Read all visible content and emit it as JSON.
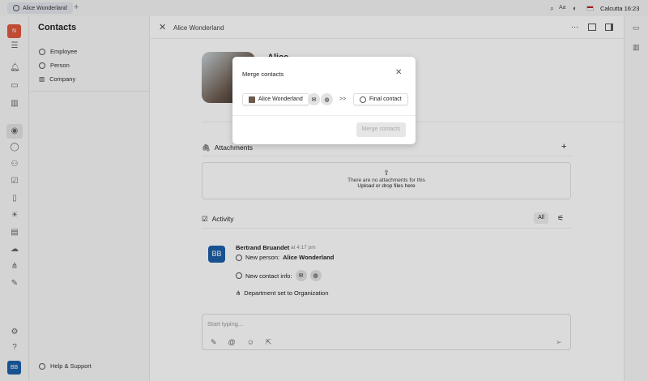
{
  "tab": {
    "title": "Alice Wonderland",
    "add": "+"
  },
  "topbar": {
    "font_label": "Aa",
    "clock": "Calcutta 16:23"
  },
  "workspace_initial": "N",
  "user_initials": "BB",
  "nav": {
    "title": "Contacts",
    "items": [
      {
        "label": "Employee"
      },
      {
        "label": "Person"
      },
      {
        "label": "Company"
      }
    ],
    "help": "Help & Support"
  },
  "header": {
    "title": "Alice Wonderland",
    "more": "···"
  },
  "profile": {
    "name": "Alice"
  },
  "attachments": {
    "title": "Attachments",
    "add": "+",
    "empty": "There are no attachments for this",
    "upload": "Upload or drop files here"
  },
  "activity": {
    "title": "Activity",
    "filter": "All",
    "entry": {
      "initials": "BB",
      "author": "Bertrand Bruandet",
      "time": "at 4:17 pm",
      "line1_prefix": "New person:",
      "line1_value": "Alice Wonderland",
      "line2": "New contact info:",
      "line3": "Department set to Organization"
    }
  },
  "composer": {
    "placeholder": "Start typing..."
  },
  "modal": {
    "title": "Merge contacts",
    "source": "Alice Wonderland",
    "arrow": ">>",
    "target": "Final contact",
    "submit": "Merge contacts"
  },
  "colors": {
    "brand": "#e0573c",
    "avatar": "#1c5fa8"
  }
}
